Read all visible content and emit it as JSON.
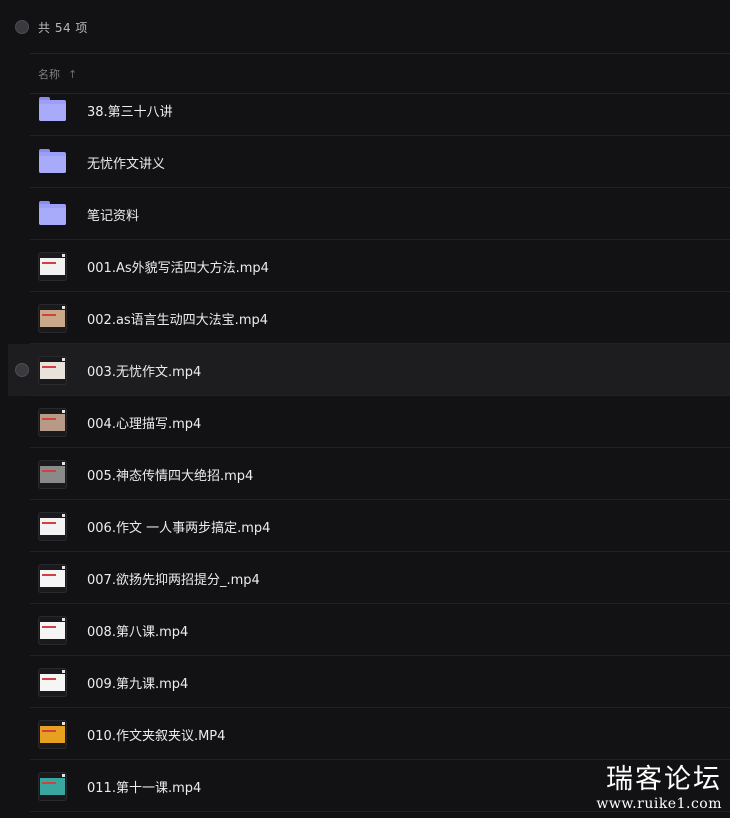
{
  "toolbar": {
    "count_label": "共 54 项"
  },
  "header": {
    "name_label": "名称",
    "sort_icon": "arrow-up-icon"
  },
  "files": [
    {
      "name": "38.第三十八讲",
      "type": "folder"
    },
    {
      "name": "无忧作文讲义",
      "type": "folder"
    },
    {
      "name": "笔记资料",
      "type": "folder"
    },
    {
      "name": "001.As外貌写活四大方法.mp4",
      "type": "video",
      "thumb_color": "#f2f2f2"
    },
    {
      "name": "002.as语言生动四大法宝.mp4",
      "type": "video",
      "thumb_color": "#c9a98a"
    },
    {
      "name": "003.无忧作文.mp4",
      "type": "video",
      "thumb_color": "#e9e2da",
      "hovered": true
    },
    {
      "name": "004.心理描写.mp4",
      "type": "video",
      "thumb_color": "#b89a88"
    },
    {
      "name": "005.神态传情四大绝招.mp4",
      "type": "video",
      "thumb_color": "#8a8a8a"
    },
    {
      "name": "006.作文 一人事两步搞定.mp4",
      "type": "video",
      "thumb_color": "#f3f3f3"
    },
    {
      "name": "007.欲扬先抑两招提分_.mp4",
      "type": "video",
      "thumb_color": "#f5f5f5"
    },
    {
      "name": "008.第八课.mp4",
      "type": "video",
      "thumb_color": "#f5f5f5"
    },
    {
      "name": "009.第九课.mp4",
      "type": "video",
      "thumb_color": "#f5f5f5"
    },
    {
      "name": "010.作文夹叙夹议.MP4",
      "type": "video",
      "thumb_color": "#e8a020"
    },
    {
      "name": "011.第十一课.mp4",
      "type": "video",
      "thumb_color": "#3aa6a0"
    }
  ],
  "watermark": {
    "text": "瑞客论坛",
    "url": "www.ruike1.com"
  }
}
